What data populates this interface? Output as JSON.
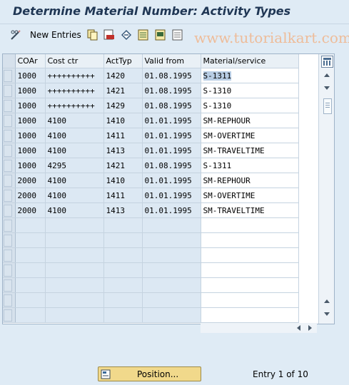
{
  "window": {
    "title": "Determine Material Number: Activity Types"
  },
  "toolbar": {
    "new_entries_label": "New Entries",
    "buttons": [
      "display-change-icon",
      "copy-icon",
      "delete-icon",
      "undo-icon",
      "select-all-icon",
      "select-block-icon",
      "deselect-all-icon"
    ]
  },
  "watermark": "www.tutorialkart.com",
  "table": {
    "columns": [
      "COAr",
      "Cost ctr",
      "ActTyp",
      "Valid from",
      "Material/service"
    ],
    "rows": [
      [
        "1000",
        "++++++++++",
        "1420",
        "01.08.1995",
        "S-1311"
      ],
      [
        "1000",
        "++++++++++",
        "1421",
        "01.08.1995",
        "S-1310"
      ],
      [
        "1000",
        "++++++++++",
        "1429",
        "01.08.1995",
        "S-1310"
      ],
      [
        "1000",
        "4100",
        "1410",
        "01.01.1995",
        "SM-REPHOUR"
      ],
      [
        "1000",
        "4100",
        "1411",
        "01.01.1995",
        "SM-OVERTIME"
      ],
      [
        "1000",
        "4100",
        "1413",
        "01.01.1995",
        "SM-TRAVELTIME"
      ],
      [
        "1000",
        "4295",
        "1421",
        "01.08.1995",
        "S-1311"
      ],
      [
        "2000",
        "4100",
        "1410",
        "01.01.1995",
        "SM-REPHOUR"
      ],
      [
        "2000",
        "4100",
        "1411",
        "01.01.1995",
        "SM-OVERTIME"
      ],
      [
        "2000",
        "4100",
        "1413",
        "01.01.1995",
        "SM-TRAVELTIME"
      ]
    ],
    "empty_rows": 7
  },
  "footer": {
    "position_button": "Position...",
    "entry_info": "Entry 1 of 10"
  },
  "colors": {
    "title": "#1f3654",
    "background": "#dfebf5",
    "key_cell": "#dce8f3",
    "button": "#f1d98b"
  }
}
